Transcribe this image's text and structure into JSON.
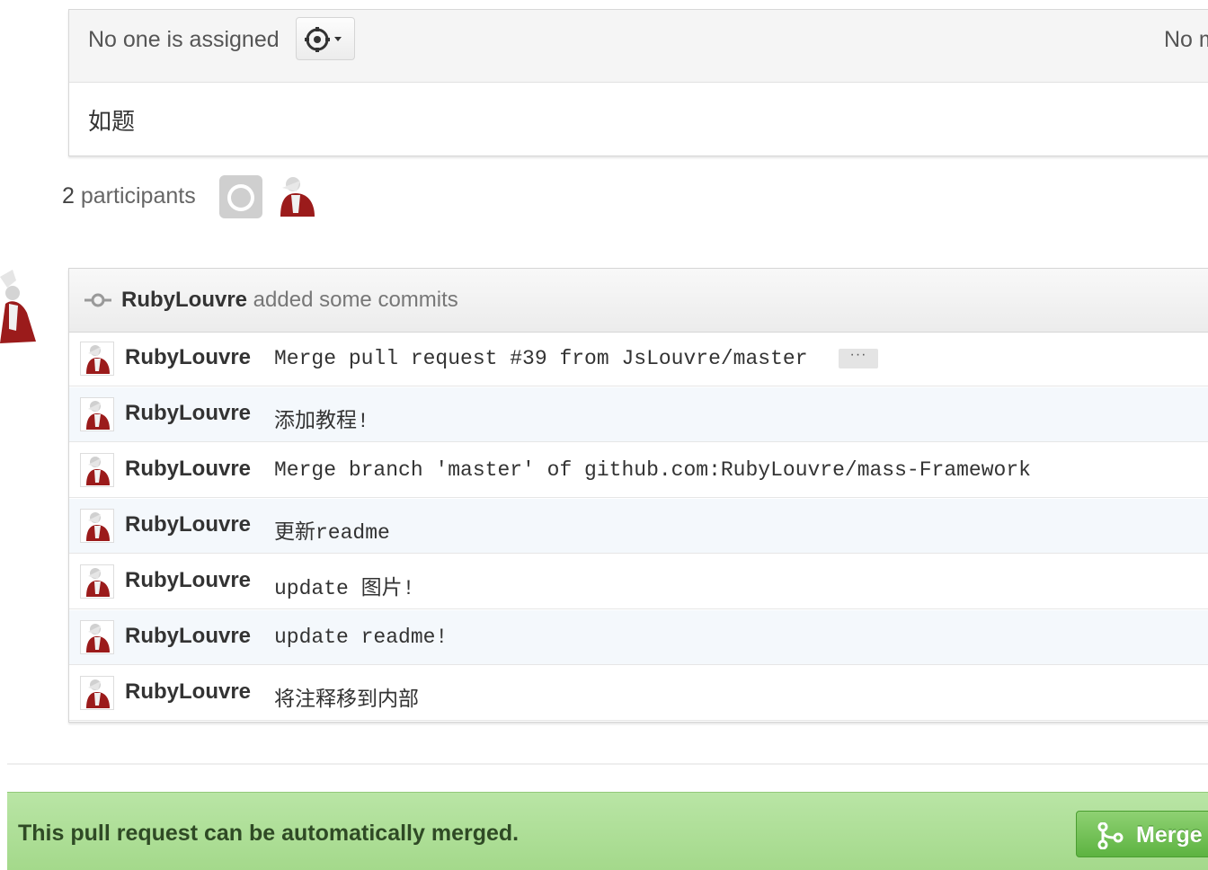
{
  "issue": {
    "assignee_text": "No one is assigned",
    "milestone_text": "No m",
    "body": "如题"
  },
  "participants": {
    "count": "2",
    "label": "participants"
  },
  "commits": {
    "header_author": "RubyLouvre",
    "header_text": " added some commits",
    "rows": [
      {
        "author": "RubyLouvre",
        "message": "Merge pull request #39 from JsLouvre/master",
        "has_more": true
      },
      {
        "author": "RubyLouvre",
        "message": "添加教程!"
      },
      {
        "author": "RubyLouvre",
        "message": "Merge branch 'master' of github.com:RubyLouvre/mass-Framework"
      },
      {
        "author": "RubyLouvre",
        "message": "更新readme"
      },
      {
        "author": "RubyLouvre",
        "message": "update 图片!"
      },
      {
        "author": "RubyLouvre",
        "message": "update readme!"
      },
      {
        "author": "RubyLouvre",
        "message": "将注释移到内部"
      }
    ],
    "more_label": "···"
  },
  "merge": {
    "status_text": "This pull request can be automatically merged.",
    "button_label": "Merge"
  },
  "colors": {
    "merge_bar": "#b3e09c",
    "merge_button": "#6cbf4d",
    "alt_row": "#f4f8fc"
  },
  "icons": {
    "gear": "gear-icon",
    "commit": "git-commit-icon",
    "merge": "git-merge-icon"
  }
}
